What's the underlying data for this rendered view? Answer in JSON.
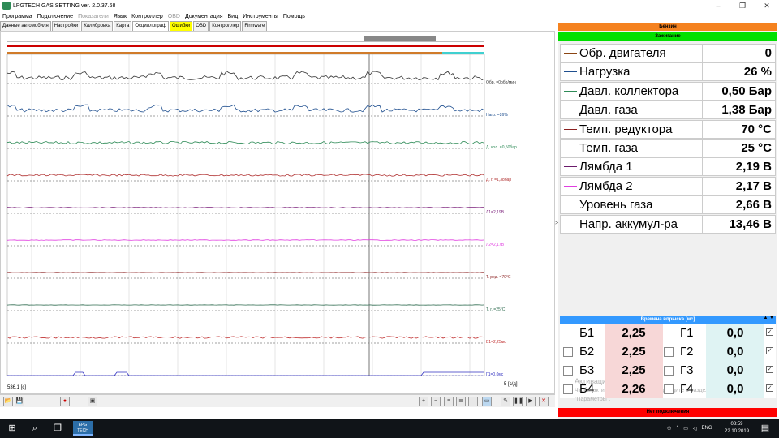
{
  "window": {
    "title": "LPGTECH GAS SETTING ver. 2.0.37.68",
    "controls": [
      "–",
      "❐",
      "✕"
    ]
  },
  "menu": [
    {
      "label": "Программа",
      "enabled": true
    },
    {
      "label": "Подключение",
      "enabled": true
    },
    {
      "label": "Показатели",
      "enabled": false
    },
    {
      "label": "Язык",
      "enabled": true
    },
    {
      "label": "Контроллер",
      "enabled": true
    },
    {
      "label": "OBD",
      "enabled": false
    },
    {
      "label": "Документация",
      "enabled": true
    },
    {
      "label": "Вид",
      "enabled": true
    },
    {
      "label": "Инструменты",
      "enabled": true
    },
    {
      "label": "Помощь",
      "enabled": true
    }
  ],
  "tabs": [
    {
      "label": "Данные автомобиля"
    },
    {
      "label": "Настройки"
    },
    {
      "label": "Калибровка"
    },
    {
      "label": "Карта"
    },
    {
      "label": "Осциллограф",
      "active": true
    },
    {
      "label": "Ошибки",
      "warn": true
    },
    {
      "label": "OBD"
    },
    {
      "label": "Контроллер"
    },
    {
      "label": "Firmware"
    }
  ],
  "oscillograph": {
    "time_readout": "536,1 [с]",
    "scale": "5 [с/д]",
    "channels": [
      {
        "label": "Обр. =0обр/мин",
        "color": "#333333"
      },
      {
        "label": "Нагр. =26%",
        "color": "#1f4f8f"
      },
      {
        "label": "Д. кол. =0,50бар",
        "color": "#2e8b57"
      },
      {
        "label": "Д. г. =1,38бар",
        "color": "#b03030"
      },
      {
        "label": "Л1=2,19В",
        "color": "#7a1f7a"
      },
      {
        "label": "Л2=2,17В",
        "color": "#e040e0"
      },
      {
        "label": "Т. ред. =70°C",
        "color": "#8b2020"
      },
      {
        "label": "Т. г. =25°C",
        "color": "#2e6b4f"
      },
      {
        "label": "Б1=2,25мс",
        "color": "#c03030"
      },
      {
        "label": "Г1=0,0мс",
        "color": "#3030c0"
      }
    ]
  },
  "right_panel": {
    "fuel_mode": "Бензин",
    "ignition": "Зажигание",
    "params": [
      {
        "name": "Обр. двигателя",
        "value": "0",
        "color": "#8b4513"
      },
      {
        "name": "Нагрузка",
        "value": "26 %",
        "color": "#1f4f8f"
      },
      {
        "name": "Давл. коллектора",
        "value": "0,50 Бар",
        "color": "#2e8b57"
      },
      {
        "name": "Давл. газа",
        "value": "1,38 Бар",
        "color": "#c04040"
      },
      {
        "name": "Темп. редуктора",
        "value": "70 °C",
        "color": "#8b2020"
      },
      {
        "name": "Темп. газа",
        "value": "25 °C",
        "color": "#2e5e4e"
      },
      {
        "name": "Лямбда 1",
        "value": "2,19 В",
        "color": "#6a1a6a"
      },
      {
        "name": "Лямбда 2",
        "value": "2,17 В",
        "color": "#e040e0"
      },
      {
        "name": "Уровень газа",
        "value": "2,66 В",
        "color": "#ffffff"
      },
      {
        "name": "Напр. аккумул-ра",
        "value": "13,46 В",
        "color": "#ffffff"
      }
    ],
    "injection_header": "Времена впрыска [мс]",
    "injection_arrows": "▲ ▼",
    "injection": [
      {
        "petrol_name": "Б1",
        "petrol_value": "2,25",
        "gas_name": "Г1",
        "gas_value": "0,0"
      },
      {
        "petrol_name": "Б2",
        "petrol_value": "2,25",
        "gas_name": "Г2",
        "gas_value": "0,0"
      },
      {
        "petrol_name": "Б3",
        "petrol_value": "2,25",
        "gas_name": "Г3",
        "gas_value": "0,0"
      },
      {
        "petrol_name": "Б4",
        "petrol_value": "2,26",
        "gas_name": "Г4",
        "gas_value": "0,0"
      }
    ],
    "watermark_line1": "Активация Windows",
    "watermark_line2": "Чтобы активировать Windows, перейдите в раздел",
    "watermark_line3": "\"Параметры\".",
    "connection": "Нет подключения"
  },
  "taskbar": {
    "app_label": "EPG TECH",
    "lang": "ENG",
    "time": "08:59",
    "date": "22.10.2019"
  }
}
